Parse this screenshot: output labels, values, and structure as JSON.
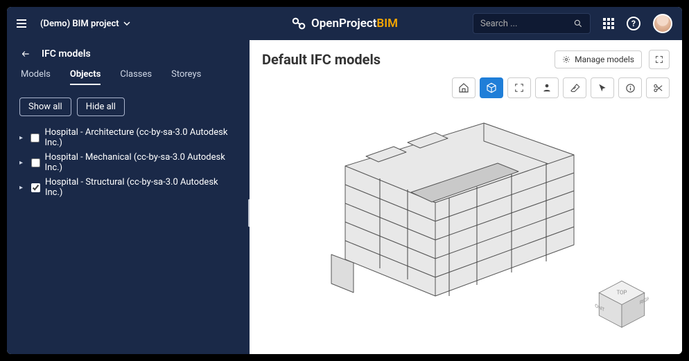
{
  "topnav": {
    "project_name": "(Demo) BIM project",
    "brand_main": "OpenProject",
    "brand_suffix": "BIM",
    "search_placeholder": "Search ..."
  },
  "sidebar": {
    "title": "IFC models",
    "tabs": [
      {
        "label": "Models",
        "active": false
      },
      {
        "label": "Objects",
        "active": true
      },
      {
        "label": "Classes",
        "active": false
      },
      {
        "label": "Storeys",
        "active": false
      }
    ],
    "show_all": "Show all",
    "hide_all": "Hide all",
    "tree": [
      {
        "label": "Hospital - Architecture (cc-by-sa-3.0 Autodesk Inc.)",
        "checked": false
      },
      {
        "label": "Hospital - Mechanical (cc-by-sa-3.0 Autodesk Inc.)",
        "checked": false
      },
      {
        "label": "Hospital - Structural (cc-by-sa-3.0 Autodesk Inc.)",
        "checked": true
      }
    ]
  },
  "main": {
    "title": "Default IFC models",
    "manage_label": "Manage models",
    "toolbar_icons": [
      "home-icon",
      "cube-icon",
      "fullscreen-icon",
      "person-icon",
      "eraser-icon",
      "cursor-icon",
      "info-icon",
      "scissors-icon"
    ],
    "navcube": {
      "top": "TOP",
      "front": "FRONT",
      "right": "RIGHT"
    }
  },
  "colors": {
    "nav_bg": "#1a2948",
    "accent": "#f7a600",
    "primary_blue": "#1f7ed8"
  }
}
